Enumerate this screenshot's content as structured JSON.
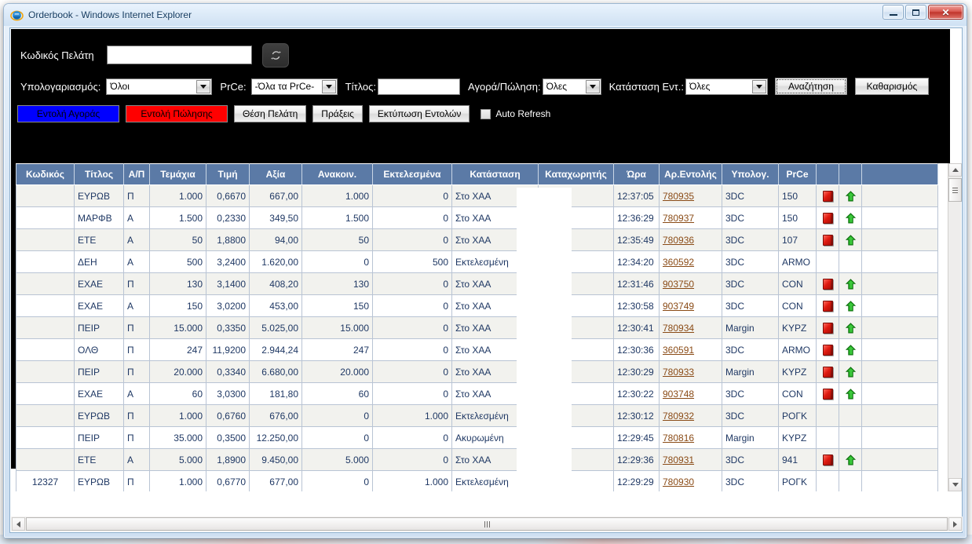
{
  "window": {
    "title": "Orderbook - Windows Internet Explorer",
    "logo_icon": "internet-explorer-icon",
    "minimize_label": "",
    "maximize_label": "",
    "close_label": "✕"
  },
  "filters": {
    "client_code_label": "Κωδικός Πελάτη",
    "client_code_value": "",
    "client_code_placeholder": "",
    "refresh_icon": "refresh-icon",
    "account_label": "Υπολογαριασμός:",
    "account_value": "Όλοι",
    "prce_label": "PrCe:",
    "prce_value": "-Όλα τα PrCe-",
    "title_label": "Τίτλος:",
    "title_value": "",
    "buysell_label": "Αγορά/Πώληση:",
    "buysell_value": "Όλες",
    "order_status_label": "Κατάσταση Εντ.:",
    "order_status_value": "Όλες",
    "search_button": "Αναζήτηση",
    "clear_button": "Καθαρισμός"
  },
  "actions": {
    "buy_order": "Εντολή Αγοράς",
    "sell_order": "Εντολή Πώλησης",
    "client_position": "Θέση Πελάτη",
    "trades": "Πράξεις",
    "print_orders": "Εκτύπωση Εντολών",
    "auto_refresh_label": "Auto Refresh",
    "auto_refresh_checked": false
  },
  "grid": {
    "columns": [
      "Κωδικός",
      "Τίτλος",
      "Α/Π",
      "Τεμάχια",
      "Τιμή",
      "Αξία",
      "Ανακοιν.",
      "Εκτελεσμένα",
      "Κατάσταση",
      "Καταχωρητής",
      "Ώρα",
      "Αρ.Εντολής",
      "Υπολογ.",
      "PrCe",
      "",
      "",
      ""
    ],
    "rows": [
      {
        "code": "",
        "symbol": "ΕΥΡΩΒ",
        "ap": "Π",
        "qty": "1.000",
        "price": "0,6670",
        "value": "667,00",
        "announced": "1.000",
        "executed": "0",
        "status": "Στο ΧΑΑ",
        "registrar": "",
        "time": "12:37:05",
        "order_no": "780935",
        "account": "3DC",
        "prce": "150",
        "cancel_icon": "cancel-icon",
        "up_icon": "arrow-up-icon"
      },
      {
        "code": "",
        "symbol": "ΜΑΡΦΒ",
        "ap": "Α",
        "qty": "1.500",
        "price": "0,2330",
        "value": "349,50",
        "announced": "1.500",
        "executed": "0",
        "status": "Στο ΧΑΑ",
        "registrar": "",
        "time": "12:36:29",
        "order_no": "780937",
        "account": "3DC",
        "prce": "150",
        "cancel_icon": "cancel-icon",
        "up_icon": "arrow-up-icon"
      },
      {
        "code": "",
        "symbol": "ΕΤΕ",
        "ap": "Α",
        "qty": "50",
        "price": "1,8800",
        "value": "94,00",
        "announced": "50",
        "executed": "0",
        "status": "Στο ΧΑΑ",
        "registrar": "",
        "time": "12:35:49",
        "order_no": "780936",
        "account": "3DC",
        "prce": "107",
        "cancel_icon": "cancel-icon",
        "up_icon": "arrow-up-icon"
      },
      {
        "code": "",
        "symbol": "ΔΕΗ",
        "ap": "Α",
        "qty": "500",
        "price": "3,2400",
        "value": "1.620,00",
        "announced": "0",
        "executed": "500",
        "status": "Εκτελεσμένη",
        "registrar": "",
        "time": "12:34:20",
        "order_no": "360592",
        "account": "3DC",
        "prce": "ARMO",
        "cancel_icon": "",
        "up_icon": ""
      },
      {
        "code": "",
        "symbol": "ΕΧΑΕ",
        "ap": "Π",
        "qty": "130",
        "price": "3,1400",
        "value": "408,20",
        "announced": "130",
        "executed": "0",
        "status": "Στο ΧΑΑ",
        "registrar": "",
        "time": "12:31:46",
        "order_no": "903750",
        "account": "3DC",
        "prce": "CON",
        "cancel_icon": "cancel-icon",
        "up_icon": "arrow-up-icon"
      },
      {
        "code": "",
        "symbol": "ΕΧΑΕ",
        "ap": "Α",
        "qty": "150",
        "price": "3,0200",
        "value": "453,00",
        "announced": "150",
        "executed": "0",
        "status": "Στο ΧΑΑ",
        "registrar": "",
        "time": "12:30:58",
        "order_no": "903749",
        "account": "3DC",
        "prce": "CON",
        "cancel_icon": "cancel-icon",
        "up_icon": "arrow-up-icon"
      },
      {
        "code": "",
        "symbol": "ΠΕΙΡ",
        "ap": "Π",
        "qty": "15.000",
        "price": "0,3350",
        "value": "5.025,00",
        "announced": "15.000",
        "executed": "0",
        "status": "Στο ΧΑΑ",
        "registrar": "",
        "time": "12:30:41",
        "order_no": "780934",
        "account": "Margin",
        "prce": "KYPZ",
        "cancel_icon": "cancel-icon",
        "up_icon": "arrow-up-icon"
      },
      {
        "code": "",
        "symbol": "ΟΛΘ",
        "ap": "Π",
        "qty": "247",
        "price": "11,9200",
        "value": "2.944,24",
        "announced": "247",
        "executed": "0",
        "status": "Στο ΧΑΑ",
        "registrar": "",
        "time": "12:30:36",
        "order_no": "360591",
        "account": "3DC",
        "prce": "ARMO",
        "cancel_icon": "cancel-icon",
        "up_icon": "arrow-up-icon"
      },
      {
        "code": "",
        "symbol": "ΠΕΙΡ",
        "ap": "Π",
        "qty": "20.000",
        "price": "0,3340",
        "value": "6.680,00",
        "announced": "20.000",
        "executed": "0",
        "status": "Στο ΧΑΑ",
        "registrar": "",
        "time": "12:30:29",
        "order_no": "780933",
        "account": "Margin",
        "prce": "KYPZ",
        "cancel_icon": "cancel-icon",
        "up_icon": "arrow-up-icon"
      },
      {
        "code": "",
        "symbol": "ΕΧΑΕ",
        "ap": "Α",
        "qty": "60",
        "price": "3,0300",
        "value": "181,80",
        "announced": "60",
        "executed": "0",
        "status": "Στο ΧΑΑ",
        "registrar": "",
        "time": "12:30:22",
        "order_no": "903748",
        "account": "3DC",
        "prce": "CON",
        "cancel_icon": "cancel-icon",
        "up_icon": "arrow-up-icon"
      },
      {
        "code": "",
        "symbol": "ΕΥΡΩΒ",
        "ap": "Π",
        "qty": "1.000",
        "price": "0,6760",
        "value": "676,00",
        "announced": "0",
        "executed": "1.000",
        "status": "Εκτελεσμένη",
        "registrar": "",
        "time": "12:30:12",
        "order_no": "780932",
        "account": "3DC",
        "prce": "ΡΟΓΚ",
        "cancel_icon": "",
        "up_icon": ""
      },
      {
        "code": "",
        "symbol": "ΠΕΙΡ",
        "ap": "Π",
        "qty": "35.000",
        "price": "0,3500",
        "value": "12.250,00",
        "announced": "0",
        "executed": "0",
        "status": "Ακυρωμένη",
        "registrar": "",
        "time": "12:29:45",
        "order_no": "780816",
        "account": "Margin",
        "prce": "KYPZ",
        "cancel_icon": "",
        "up_icon": ""
      },
      {
        "code": "",
        "symbol": "ΕΤΕ",
        "ap": "Α",
        "qty": "5.000",
        "price": "1,8900",
        "value": "9.450,00",
        "announced": "5.000",
        "executed": "0",
        "status": "Στο ΧΑΑ",
        "registrar": "",
        "time": "12:29:36",
        "order_no": "780931",
        "account": "3DC",
        "prce": "941",
        "cancel_icon": "cancel-icon",
        "up_icon": "arrow-up-icon"
      },
      {
        "code": "12327",
        "symbol": "ΕΥΡΩΒ",
        "ap": "Π",
        "qty": "1.000",
        "price": "0,6770",
        "value": "677,00",
        "announced": "0",
        "executed": "1.000",
        "status": "Εκτελεσμένη",
        "registrar": "",
        "time": "12:29:29",
        "order_no": "780930",
        "account": "3DC",
        "prce": "ΡΟΓΚ",
        "cancel_icon": "",
        "up_icon": ""
      }
    ]
  },
  "scrollbars": {
    "v_up_icon": "scroll-up-icon",
    "v_down_icon": "scroll-down-icon",
    "h_left_icon": "scroll-left-icon",
    "h_right_icon": "scroll-right-icon"
  },
  "colors": {
    "header_blue": "#5b7aa6",
    "buy_blue": "#0000ff",
    "sell_red": "#ff0000",
    "chrome_black": "#000000",
    "link_brown": "#8a4b16"
  }
}
